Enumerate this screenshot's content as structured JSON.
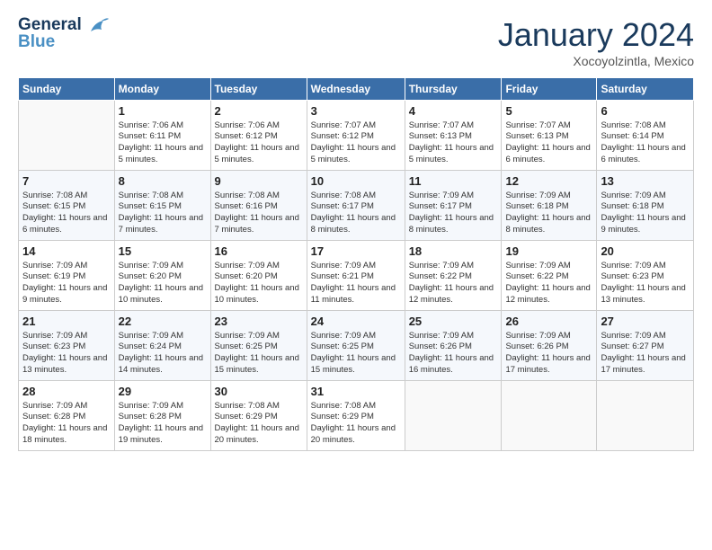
{
  "logo": {
    "line1": "General",
    "line2": "Blue"
  },
  "title": "January 2024",
  "location": "Xocoyolzintla, Mexico",
  "days_of_week": [
    "Sunday",
    "Monday",
    "Tuesday",
    "Wednesday",
    "Thursday",
    "Friday",
    "Saturday"
  ],
  "weeks": [
    [
      null,
      {
        "num": "1",
        "sunrise": "7:06 AM",
        "sunset": "6:11 PM",
        "daylight": "11 hours and 5 minutes."
      },
      {
        "num": "2",
        "sunrise": "7:06 AM",
        "sunset": "6:12 PM",
        "daylight": "11 hours and 5 minutes."
      },
      {
        "num": "3",
        "sunrise": "7:07 AM",
        "sunset": "6:12 PM",
        "daylight": "11 hours and 5 minutes."
      },
      {
        "num": "4",
        "sunrise": "7:07 AM",
        "sunset": "6:13 PM",
        "daylight": "11 hours and 5 minutes."
      },
      {
        "num": "5",
        "sunrise": "7:07 AM",
        "sunset": "6:13 PM",
        "daylight": "11 hours and 6 minutes."
      },
      {
        "num": "6",
        "sunrise": "7:08 AM",
        "sunset": "6:14 PM",
        "daylight": "11 hours and 6 minutes."
      }
    ],
    [
      {
        "num": "7",
        "sunrise": "7:08 AM",
        "sunset": "6:15 PM",
        "daylight": "11 hours and 6 minutes."
      },
      {
        "num": "8",
        "sunrise": "7:08 AM",
        "sunset": "6:15 PM",
        "daylight": "11 hours and 7 minutes."
      },
      {
        "num": "9",
        "sunrise": "7:08 AM",
        "sunset": "6:16 PM",
        "daylight": "11 hours and 7 minutes."
      },
      {
        "num": "10",
        "sunrise": "7:08 AM",
        "sunset": "6:17 PM",
        "daylight": "11 hours and 8 minutes."
      },
      {
        "num": "11",
        "sunrise": "7:09 AM",
        "sunset": "6:17 PM",
        "daylight": "11 hours and 8 minutes."
      },
      {
        "num": "12",
        "sunrise": "7:09 AM",
        "sunset": "6:18 PM",
        "daylight": "11 hours and 8 minutes."
      },
      {
        "num": "13",
        "sunrise": "7:09 AM",
        "sunset": "6:18 PM",
        "daylight": "11 hours and 9 minutes."
      }
    ],
    [
      {
        "num": "14",
        "sunrise": "7:09 AM",
        "sunset": "6:19 PM",
        "daylight": "11 hours and 9 minutes."
      },
      {
        "num": "15",
        "sunrise": "7:09 AM",
        "sunset": "6:20 PM",
        "daylight": "11 hours and 10 minutes."
      },
      {
        "num": "16",
        "sunrise": "7:09 AM",
        "sunset": "6:20 PM",
        "daylight": "11 hours and 10 minutes."
      },
      {
        "num": "17",
        "sunrise": "7:09 AM",
        "sunset": "6:21 PM",
        "daylight": "11 hours and 11 minutes."
      },
      {
        "num": "18",
        "sunrise": "7:09 AM",
        "sunset": "6:22 PM",
        "daylight": "11 hours and 12 minutes."
      },
      {
        "num": "19",
        "sunrise": "7:09 AM",
        "sunset": "6:22 PM",
        "daylight": "11 hours and 12 minutes."
      },
      {
        "num": "20",
        "sunrise": "7:09 AM",
        "sunset": "6:23 PM",
        "daylight": "11 hours and 13 minutes."
      }
    ],
    [
      {
        "num": "21",
        "sunrise": "7:09 AM",
        "sunset": "6:23 PM",
        "daylight": "11 hours and 13 minutes."
      },
      {
        "num": "22",
        "sunrise": "7:09 AM",
        "sunset": "6:24 PM",
        "daylight": "11 hours and 14 minutes."
      },
      {
        "num": "23",
        "sunrise": "7:09 AM",
        "sunset": "6:25 PM",
        "daylight": "11 hours and 15 minutes."
      },
      {
        "num": "24",
        "sunrise": "7:09 AM",
        "sunset": "6:25 PM",
        "daylight": "11 hours and 15 minutes."
      },
      {
        "num": "25",
        "sunrise": "7:09 AM",
        "sunset": "6:26 PM",
        "daylight": "11 hours and 16 minutes."
      },
      {
        "num": "26",
        "sunrise": "7:09 AM",
        "sunset": "6:26 PM",
        "daylight": "11 hours and 17 minutes."
      },
      {
        "num": "27",
        "sunrise": "7:09 AM",
        "sunset": "6:27 PM",
        "daylight": "11 hours and 17 minutes."
      }
    ],
    [
      {
        "num": "28",
        "sunrise": "7:09 AM",
        "sunset": "6:28 PM",
        "daylight": "11 hours and 18 minutes."
      },
      {
        "num": "29",
        "sunrise": "7:09 AM",
        "sunset": "6:28 PM",
        "daylight": "11 hours and 19 minutes."
      },
      {
        "num": "30",
        "sunrise": "7:08 AM",
        "sunset": "6:29 PM",
        "daylight": "11 hours and 20 minutes."
      },
      {
        "num": "31",
        "sunrise": "7:08 AM",
        "sunset": "6:29 PM",
        "daylight": "11 hours and 20 minutes."
      },
      null,
      null,
      null
    ]
  ],
  "labels": {
    "sunrise_prefix": "Sunrise: ",
    "sunset_prefix": "Sunset: ",
    "daylight_prefix": "Daylight: "
  }
}
